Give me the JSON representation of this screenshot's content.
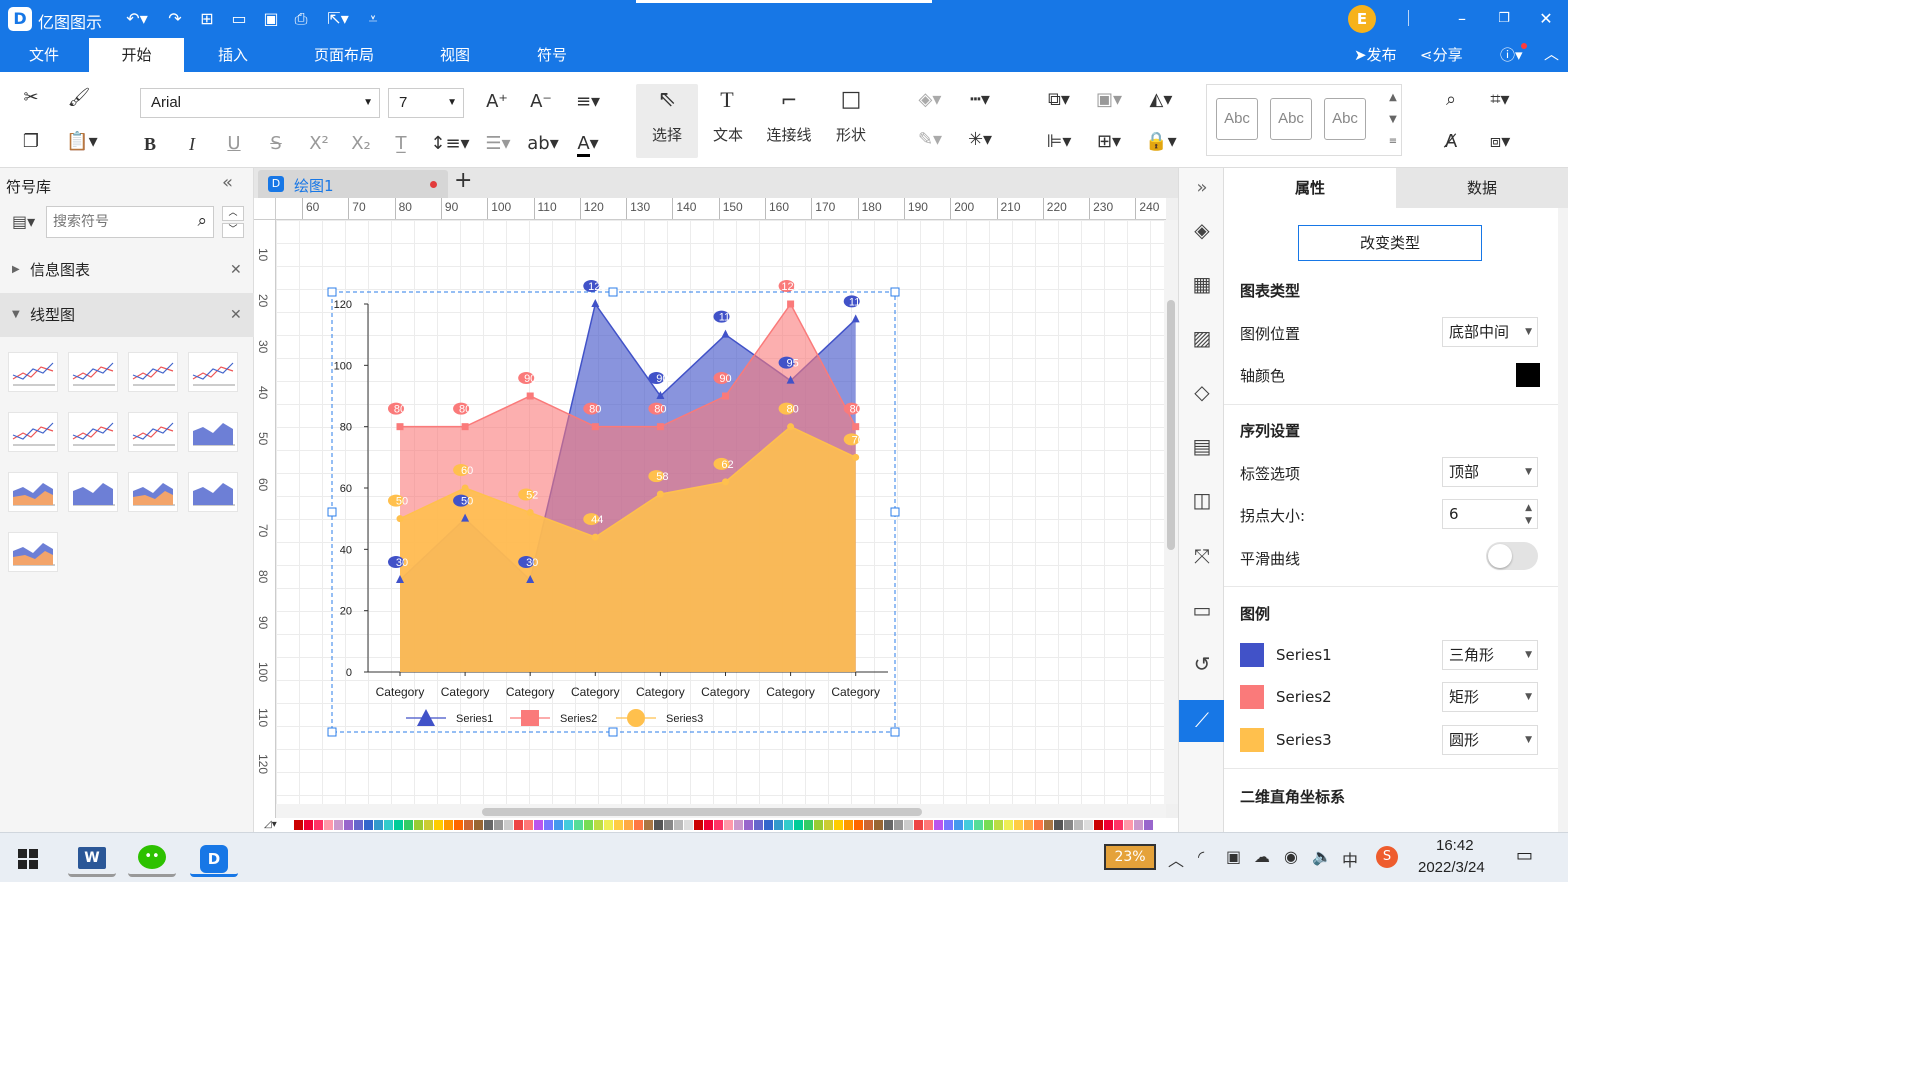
{
  "app": {
    "title": "亿图图示",
    "logo_letter": "D"
  },
  "user": {
    "avatar_letter": "E"
  },
  "window_controls": {
    "minimize": "–",
    "restore": "❐",
    "close": "✕"
  },
  "header_actions": {
    "publish": "发布",
    "share": "分享"
  },
  "menu": {
    "tabs": [
      "文件",
      "开始",
      "插入",
      "页面布局",
      "视图",
      "符号"
    ],
    "active": "开始"
  },
  "ribbon": {
    "font_name": "Arial",
    "font_size": "7",
    "tools": {
      "select": "选择",
      "text": "文本",
      "connector": "连接线",
      "shape": "形状"
    },
    "style_preview": [
      "Abc",
      "Abc",
      "Abc"
    ]
  },
  "left_panel": {
    "title": "符号库",
    "search_placeholder": "搜索符号",
    "categories": [
      {
        "label": "信息图表",
        "expanded": false
      },
      {
        "label": "线型图",
        "expanded": true
      }
    ]
  },
  "document": {
    "tab_name": "绘图1",
    "add_tab": "+"
  },
  "ruler": {
    "h": [
      "60",
      "70",
      "80",
      "90",
      "100",
      "110",
      "120",
      "130",
      "140",
      "150",
      "160",
      "170",
      "180",
      "190",
      "200",
      "210",
      "220",
      "230",
      "240"
    ],
    "v": [
      "10",
      "20",
      "30",
      "40",
      "50",
      "60",
      "70",
      "80",
      "90",
      "100",
      "110",
      "120"
    ]
  },
  "chart_data": {
    "type": "area",
    "categories": [
      "Category",
      "Category",
      "Category",
      "Category",
      "Category",
      "Category",
      "Category",
      "Category"
    ],
    "ylim": [
      0,
      120
    ],
    "yticks": [
      0,
      20,
      40,
      60,
      80,
      100,
      120
    ],
    "grid": false,
    "legend_position": "bottom-center",
    "series": [
      {
        "name": "Series1",
        "values": [
          30,
          50,
          30,
          120,
          90,
          110,
          95,
          115
        ],
        "color": "#4152c8",
        "marker": "triangle"
      },
      {
        "name": "Series2",
        "values": [
          80,
          80,
          90,
          80,
          80,
          90,
          120,
          80
        ],
        "color": "#fa7a7a",
        "marker": "rect"
      },
      {
        "name": "Series3",
        "values": [
          50,
          60,
          52,
          44,
          58,
          62,
          80,
          70
        ],
        "color": "#ffc04d",
        "marker": "circle"
      }
    ]
  },
  "right_panel": {
    "tabs": [
      "属性",
      "数据"
    ],
    "active_tab": "属性",
    "change_type_button": "改变类型",
    "chart_type_header": "图表类型",
    "legend_position_label": "图例位置",
    "legend_position_value": "底部中间",
    "axis_color_label": "轴颜色",
    "axis_color": "#000000",
    "series_settings_header": "序列设置",
    "label_option_label": "标签选项",
    "label_option_value": "顶部",
    "point_size_label": "拐点大小:",
    "point_size_value": "6",
    "smooth_curve_label": "平滑曲线",
    "smooth_curve_on": false,
    "legend_header": "图例",
    "legend_items": [
      {
        "name": "Series1",
        "color": "#4152c8",
        "marker": "三角形"
      },
      {
        "name": "Series2",
        "color": "#fa7a7a",
        "marker": "矩形"
      },
      {
        "name": "Series3",
        "color": "#ffc04d",
        "marker": "圆形"
      }
    ],
    "axis_system_header": "二维直角坐标系"
  },
  "taskbar": {
    "battery": "23%",
    "time": "16:42",
    "date": "2022/3/24",
    "ime": "中"
  }
}
